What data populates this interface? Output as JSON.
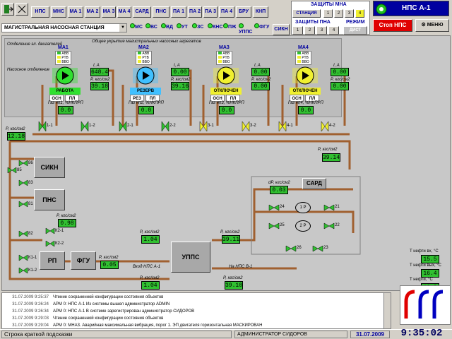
{
  "toolbar": {
    "icons": [
      "exit-icon",
      "signal-icon"
    ],
    "buttons": [
      "НПС",
      "МНС",
      "МА 1",
      "МА 2",
      "МА 3",
      "МА 4",
      "САРД",
      "ПНС",
      "ПА 1",
      "ПА 2",
      "ПА 3",
      "ПА 4",
      "БРУ",
      "КНП"
    ],
    "row2": [
      "МС",
      "ВС",
      "ВД",
      "УТ",
      "ЗС",
      "КНС",
      "ПЖ",
      "УППС",
      "ФГУ"
    ],
    "station_select": "МАГИСТРАЛЬНАЯ НАСОСНАЯ СТАНЦИЯ",
    "sikn": "СИКН"
  },
  "protections": {
    "mna_title": "ЗАЩИТЫ МНА",
    "station": "СТАНЦИЯ",
    "mna_buttons": [
      "1",
      "2",
      "3",
      "4"
    ],
    "pna_title": "ЗАЩИТЫ ПНА",
    "pna_buttons": [
      "1",
      "2",
      "3",
      "4"
    ],
    "mode_title": "РЕЖИМ",
    "mode_value": "ДИСТ"
  },
  "header": {
    "nps_title": "НПС А-1",
    "stop_label": "Стоп НПС",
    "menu_label": "МЕНЮ"
  },
  "main": {
    "area_engines": "Отделение эл. двигателей",
    "area_pumps": "Насосное отделение",
    "common_cover": "Общее укрытие магистральных насосных агрегатов",
    "aggregates": [
      {
        "name": "МА1",
        "status": "РАБОТА",
        "status_color": "#30e030",
        "current_label": "I, A",
        "current": "648.4",
        "pressure_label": "P, кгс/см2",
        "pressure": "39.18",
        "valve_a": "ОСН",
        "valve_b": "ПЛ",
        "gas_label": "Газ нп1, %НКПРП",
        "gas": "0.0",
        "sensors": [
          "АВВ",
          "РТВ",
          "ВВО"
        ]
      },
      {
        "name": "МА2",
        "status": "РЕЗЕРВ",
        "status_color": "#40c0ff",
        "current_label": "I, A",
        "current": "0.00",
        "pressure_label": "P, кгс/см2",
        "pressure": "39.16",
        "valve_a": "РЕЗ",
        "valve_b": "ПЛ",
        "gas_label": "Газ нп2, %НКПРП",
        "gas": "0.0",
        "sensors": [
          "АВВ",
          "РТВ",
          "ВВО"
        ]
      },
      {
        "name": "МА3",
        "status": "ОТКЛЮЧЕН",
        "status_color": "#f0f030",
        "current_label": "I, A",
        "current": "0.00",
        "pressure_label": "P, кгс/см2",
        "pressure": "0.00",
        "valve_a": "ОСН",
        "valve_b": "ПЛ",
        "gas_label": "Газ нп3, %НКПРП",
        "gas": "0.0",
        "sensors": [
          "АВВ",
          "РТВ",
          "ВВО"
        ]
      },
      {
        "name": "МА4",
        "status": "ОТКЛЮЧЕН",
        "status_color": "#f0f030",
        "current_label": "I, A",
        "current": "0.00",
        "pressure_label": "P, кгс/см2",
        "pressure": "0.00",
        "valve_a": "ОСН",
        "valve_b": "ПЛ",
        "gas_label": "Газ нп4, %НКПРП",
        "gas": "0.0",
        "sensors": [
          "АВВ",
          "РТВ",
          "ВВО"
        ]
      }
    ],
    "valves_top": [
      "1-1",
      "1-2",
      "2-1",
      "2-2",
      "3-1",
      "3-2",
      "4-1",
      "4-2"
    ],
    "p_in_label": "P, кгс/см2",
    "p_in": "12.18",
    "p_out_label": "P, кгс/см2",
    "p_out": "39.14",
    "units": {
      "sikn": "СИКН",
      "pns": "ПНС",
      "rp": "РП",
      "fgu": "ФГУ",
      "upps": "УППС",
      "sard": "САРД"
    },
    "valves_left": [
      "86",
      "85",
      "83",
      "81",
      "82",
      "К2-1",
      "К2-2",
      "К1-1",
      "К1-2"
    ],
    "p_k2_label": "P, кгс/см2",
    "p_k2": "0.98",
    "p_rp_label": "P, кгс/см2",
    "p_rp": "1.04",
    "p_fgu_label": "P, кгс/см2",
    "p_fgu": "0.05",
    "p_upps_label": "P, кгс/см2",
    "p_upps": "39.11",
    "in_label": "Вход НПС А-1",
    "in_p_label": "P, кгс/см2",
    "in_p": "1.04",
    "out_label": "На НПС В-1",
    "out_p_label": "P, кгс/см2",
    "out_p": "39.10",
    "sard_dp_label": "dP, кгс/см2",
    "sard_dp": "0.03",
    "sard_regs": [
      "1 Р",
      "2 Р"
    ],
    "sard_valves": [
      "24",
      "21",
      "25",
      "22",
      "26",
      "23"
    ]
  },
  "temps": [
    {
      "label": "T нефти вх, °C",
      "value": "15.5"
    },
    {
      "label": "T нефти вых, °C",
      "value": "16.4"
    },
    {
      "label": "T нефти, °C",
      "value": "12.8"
    }
  ],
  "log": [
    {
      "time": "31.07.2009 9:25:37",
      "text": "Чтение сохраненной конфигурации состояния объектов"
    },
    {
      "time": "31.07.2009 9:26:24",
      "text": "АРМ 0: НПС А-1 Из системы вышел администратор ADMIN"
    },
    {
      "time": "31.07.2009 9:26:34",
      "text": "АРМ 0: НПС А-1 В системе зарегистрирован администратор СИДОРОВ"
    },
    {
      "time": "31.07.2009 9:29:03",
      "text": "Чтение сохраненной конфигурации состояния объектов"
    },
    {
      "time": "31.07.2009 9:29:04",
      "text": "АРМ 0: МНА3. Аварийная максимальная вибрация, порог 1. ЭП двигателя горизонтальная МАСКИРОВАН"
    }
  ],
  "statusbar": {
    "hint": "Строка краткой подсказки",
    "user": "АДМИНИСТРАТОР СИДОРОВ",
    "date": "31.07.2009",
    "time": "9:35:02"
  },
  "colors": {
    "pipe": "#a06030",
    "green_val": "#30c030",
    "stop_red": "#e00000"
  }
}
